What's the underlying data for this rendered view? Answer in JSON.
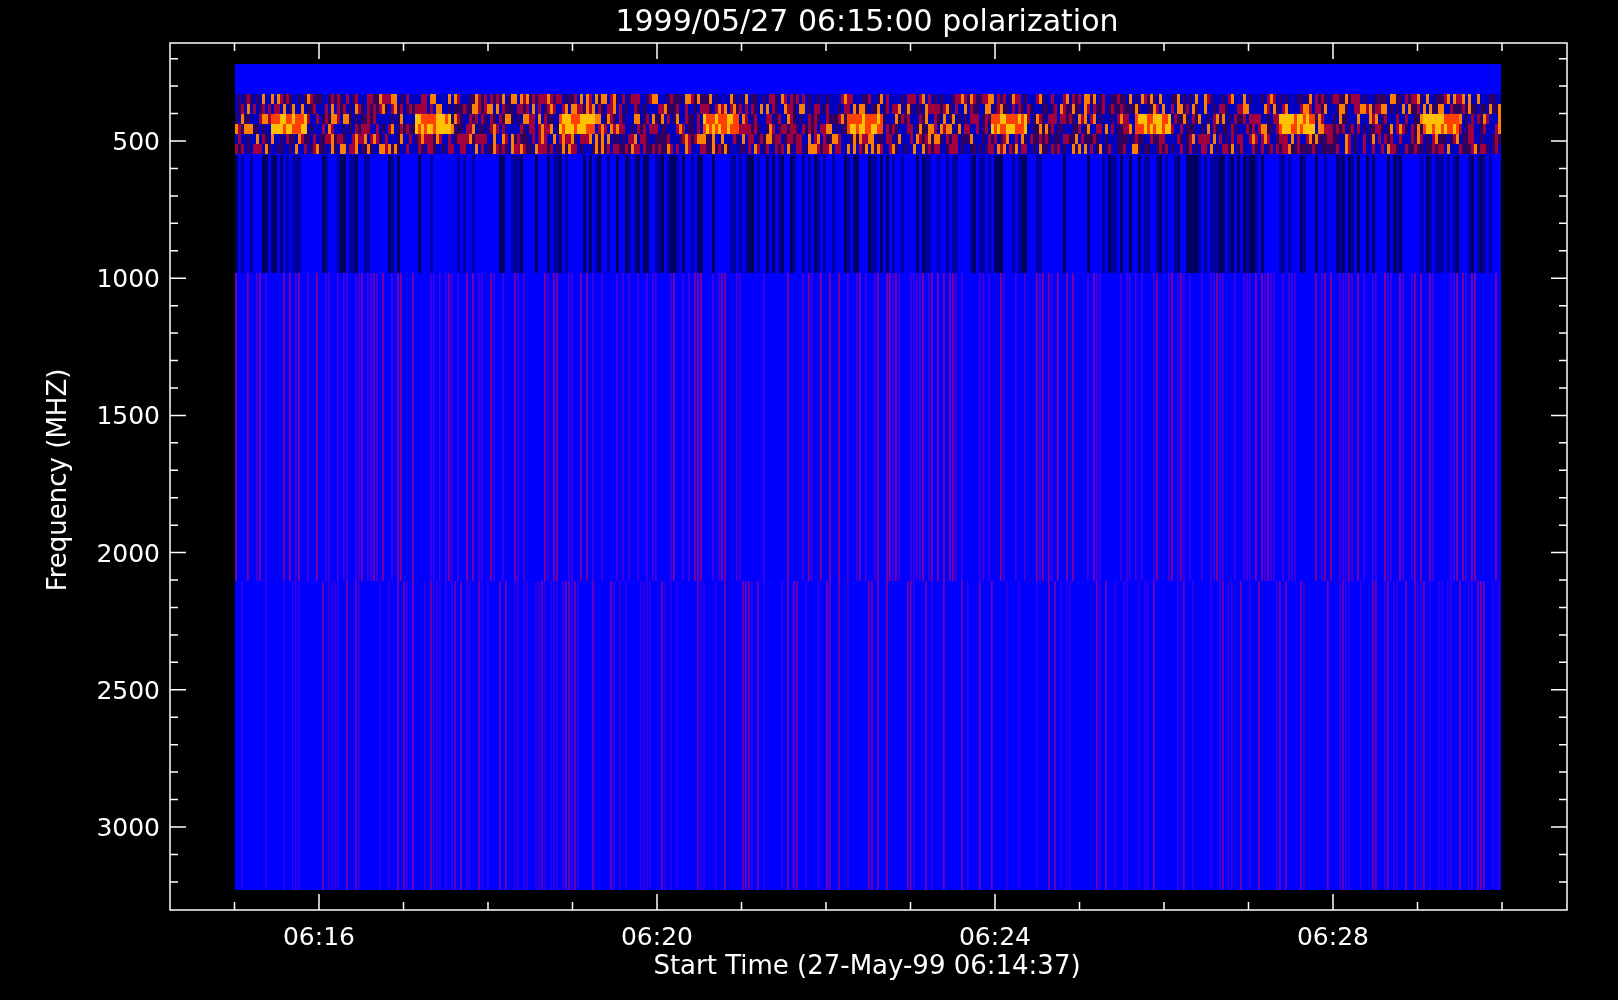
{
  "plot": {
    "title": "1999/05/27 06:15:00 polarization",
    "y_axis": {
      "label": "Frequency (MHZ)",
      "tick_labels": [
        "500",
        "1000",
        "1500",
        "2000",
        "2500",
        "3000"
      ]
    },
    "x_axis": {
      "label": "Start Time (27-May-99 06:14:37)",
      "tick_labels": [
        "06:16",
        "06:20",
        "06:24",
        "06:28"
      ]
    }
  }
}
